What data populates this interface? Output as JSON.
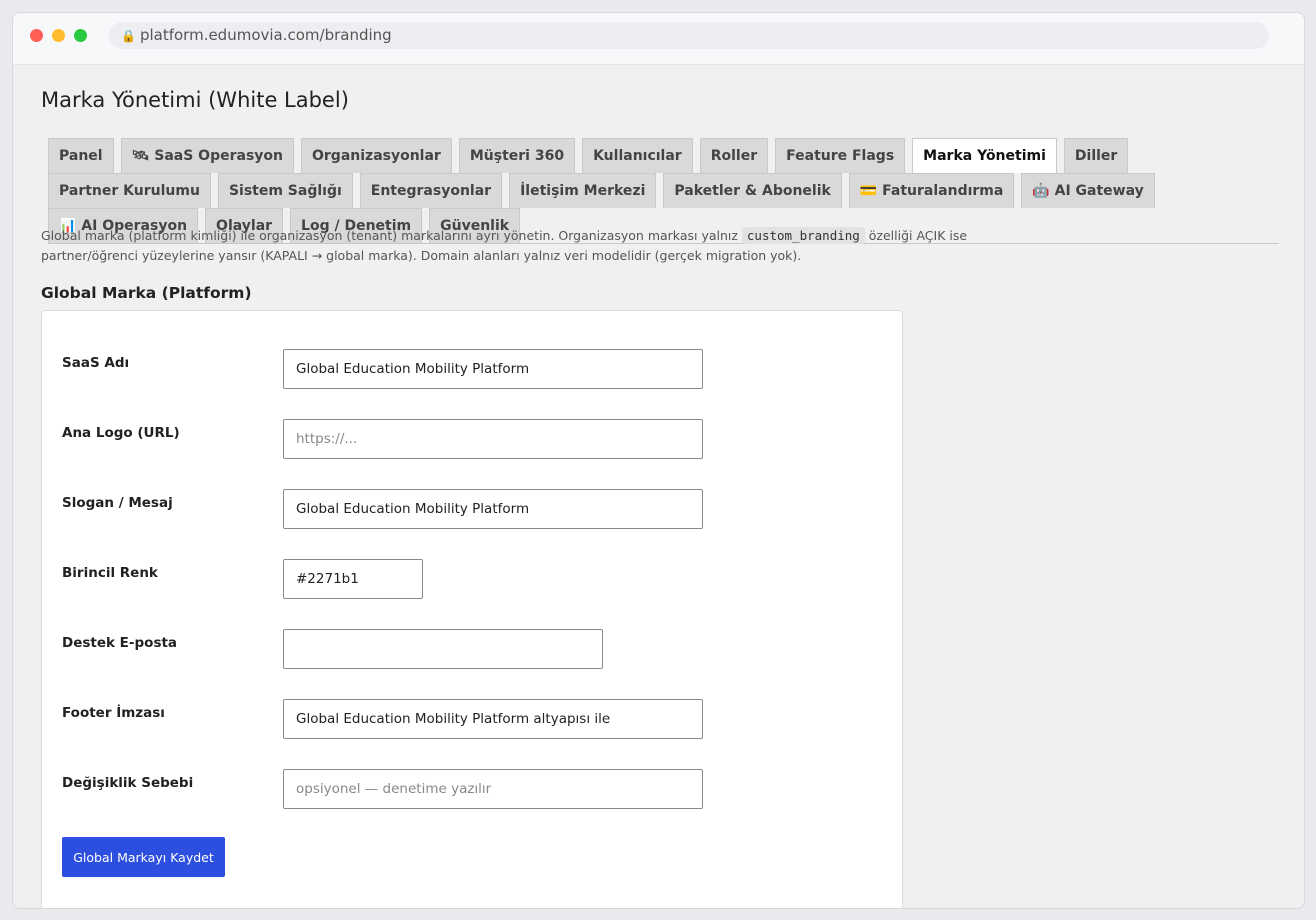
{
  "browser": {
    "url": "platform.edumovia.com/branding",
    "lock_glyph": "🔒"
  },
  "page": {
    "title": "Marka Yönetimi (White Label)"
  },
  "tabs": [
    {
      "label": "Panel",
      "active": false
    },
    {
      "label": "🛰 SaaS Operasyon",
      "active": false
    },
    {
      "label": "Organizasyonlar",
      "active": false
    },
    {
      "label": "Müşteri 360",
      "active": false
    },
    {
      "label": "Kullanıcılar",
      "active": false
    },
    {
      "label": "Roller",
      "active": false
    },
    {
      "label": "Feature Flags",
      "active": false
    },
    {
      "label": "Marka Yönetimi",
      "active": true
    },
    {
      "label": "Diller",
      "active": false
    },
    {
      "label": "Partner Kurulumu",
      "active": false
    },
    {
      "label": "Sistem Sağlığı",
      "active": false
    },
    {
      "label": "Entegrasyonlar",
      "active": false
    },
    {
      "label": "İletişim Merkezi",
      "active": false
    },
    {
      "label": "Paketler & Abonelik",
      "active": false
    },
    {
      "label": "💳 Faturalandırma",
      "active": false
    },
    {
      "label": "🤖 AI Gateway",
      "active": false
    },
    {
      "label": "📊 AI Operasyon",
      "active": false
    },
    {
      "label": "Olaylar",
      "active": false
    },
    {
      "label": "Log / Denetim",
      "active": false
    },
    {
      "label": "Güvenlik",
      "active": false
    }
  ],
  "description": {
    "part1": "Global marka (platform kimliği) ile organizasyon (tenant) markalarını ayrı yönetin. Organizasyon markası yalnız ",
    "code": "custom_branding",
    "part2": " özelliği AÇIK ise partner/öğrenci yüzeylerine yansır (KAPALI → global marka). Domain alanları yalnız veri modelidir (gerçek migration yok)."
  },
  "section": {
    "title": "Global Marka (Platform)"
  },
  "form": {
    "saas_name": {
      "label": "SaaS Adı",
      "value": "Global Education Mobility Platform",
      "placeholder": ""
    },
    "logo_url": {
      "label": "Ana Logo (URL)",
      "value": "",
      "placeholder": "https://..."
    },
    "slogan": {
      "label": "Slogan / Mesaj",
      "value": "Global Education Mobility Platform",
      "placeholder": ""
    },
    "primary_color": {
      "label": "Birincil Renk",
      "value": "#2271b1",
      "placeholder": ""
    },
    "support_email": {
      "label": "Destek E-posta",
      "value": "",
      "placeholder": ""
    },
    "footer_signature": {
      "label": "Footer İmzası",
      "value": "Global Education Mobility Platform altyapısı ile",
      "placeholder": ""
    },
    "change_reason": {
      "label": "Değişiklik Sebebi",
      "value": "",
      "placeholder": "opsiyonel — denetime yazılır"
    },
    "save_label": "Global Markayı Kaydet"
  },
  "colors": {
    "primary_button": "#2d4fe0",
    "active_tab": "#ffffff",
    "inactive_tab": "#d9d9d9"
  }
}
